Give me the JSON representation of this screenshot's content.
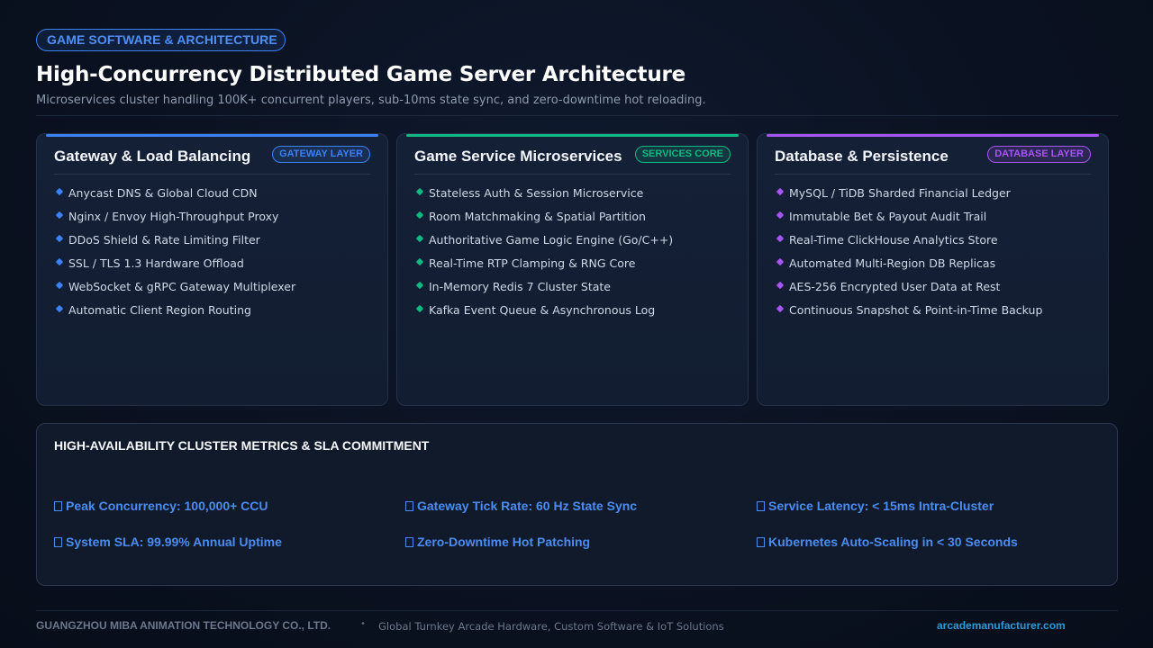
{
  "header": {
    "category_tag": "GAME SOFTWARE & ARCHITECTURE",
    "title": "High-Concurrency Distributed Game Server Architecture",
    "subtitle": "Microservices cluster handling 100K+ concurrent players, sub-10ms state sync, and zero-downtime hot reloading."
  },
  "cards": [
    {
      "title": "Gateway & Load Balancing",
      "badge": "GATEWAY LAYER",
      "accent": "#3b82f6",
      "items": [
        "Anycast DNS & Global Cloud CDN",
        "Nginx / Envoy High-Throughput Proxy",
        "DDoS Shield & Rate Limiting Filter",
        "SSL / TLS 1.3 Hardware Offload",
        "WebSocket & gRPC Gateway Multiplexer",
        "Automatic Client Region Routing"
      ]
    },
    {
      "title": "Game Service Microservices",
      "badge": "SERVICES CORE",
      "accent": "#10b981",
      "items": [
        "Stateless Auth & Session Microservice",
        "Room Matchmaking & Spatial Partition",
        "Authoritative Game Logic Engine (Go/C++)",
        "Real-Time RTP Clamping & RNG Core",
        "In-Memory Redis 7 Cluster State",
        "Kafka Event Queue & Asynchronous Log"
      ]
    },
    {
      "title": "Database & Persistence",
      "badge": "DATABASE LAYER",
      "accent": "#a855f7",
      "items": [
        "MySQL / TiDB Sharded Financial Ledger",
        "Immutable Bet & Payout Audit Trail",
        "Real-Time ClickHouse Analytics Store",
        "Automated Multi-Region DB Replicas",
        "AES-256 Encrypted User Data at Rest",
        "Continuous Snapshot & Point-in-Time Backup"
      ]
    }
  ],
  "metrics": {
    "title": "HIGH-AVAILABILITY CLUSTER METRICS & SLA COMMITMENT",
    "items": [
      "Peak Concurrency: 100,000+ CCU",
      "Gateway Tick Rate: 60 Hz State Sync",
      "Service Latency: < 15ms Intra-Cluster",
      "System SLA: 99.99% Annual Uptime",
      "Zero-Downtime Hot Patching",
      "Kubernetes Auto-Scaling in < 30 Seconds"
    ]
  },
  "footer": {
    "company": "GUANGZHOU MIBA ANIMATION TECHNOLOGY CO., LTD.",
    "bullet": "•",
    "tagline": "Global Turnkey Arcade Hardware, Custom Software & IoT Solutions",
    "website": "arcademanufacturer.com"
  }
}
